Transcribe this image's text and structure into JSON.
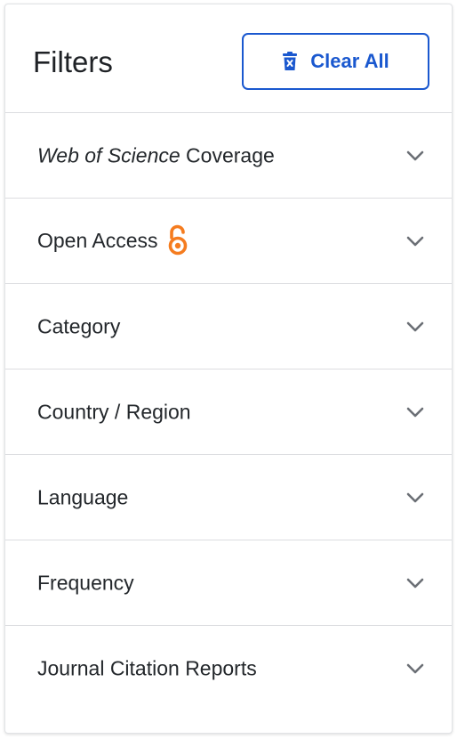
{
  "filters": {
    "title": "Filters",
    "clear_all_label": "Clear All",
    "accent_color": "#1a58cf",
    "items": [
      {
        "label_italic": "Web of Science",
        "label_rest": " Coverage"
      },
      {
        "label": "Open Access",
        "icon": "open-access-icon",
        "icon_color": "#f57c1f"
      },
      {
        "label": "Category"
      },
      {
        "label": "Country / Region"
      },
      {
        "label": "Language"
      },
      {
        "label": "Frequency"
      },
      {
        "label": "Journal Citation Reports"
      }
    ]
  }
}
